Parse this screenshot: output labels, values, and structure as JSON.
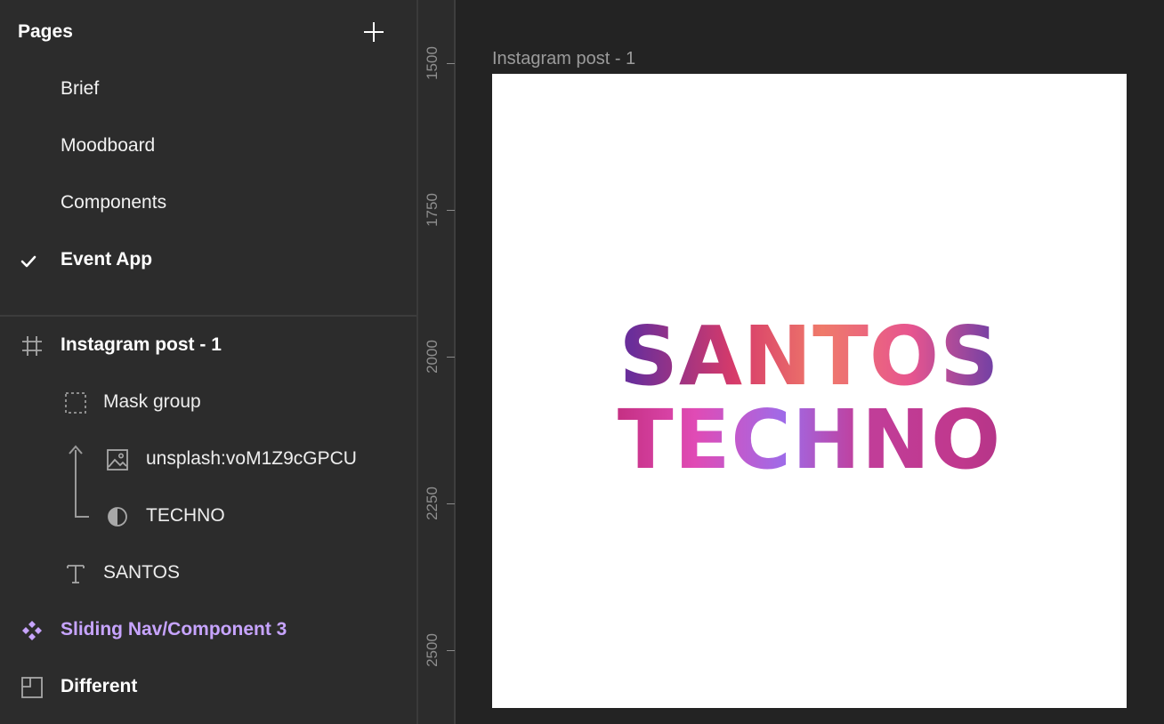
{
  "pages": {
    "title": "Pages",
    "items": [
      {
        "label": "Brief",
        "active": false
      },
      {
        "label": "Moodboard",
        "active": false
      },
      {
        "label": "Components",
        "active": false
      },
      {
        "label": "Event App",
        "active": true
      }
    ]
  },
  "layers": {
    "frame": "Instagram post - 1",
    "mask_group": "Mask group",
    "image": "unsplash:voM1Z9cGPCU",
    "mask_text": "TECHNO",
    "text": "SANTOS",
    "component": "Sliding Nav/Component 3",
    "other": "Different"
  },
  "ruler": {
    "labels": [
      "1500",
      "1750",
      "2000",
      "2250",
      "2500"
    ]
  },
  "canvas": {
    "frame_label": "Instagram post - 1",
    "headline_line1": "SANTOS",
    "headline_line2": "TECHNO"
  },
  "colors": {
    "sidebar_bg": "#2c2c2c",
    "canvas_bg": "#232323",
    "component_purple": "#c7a4ff"
  }
}
